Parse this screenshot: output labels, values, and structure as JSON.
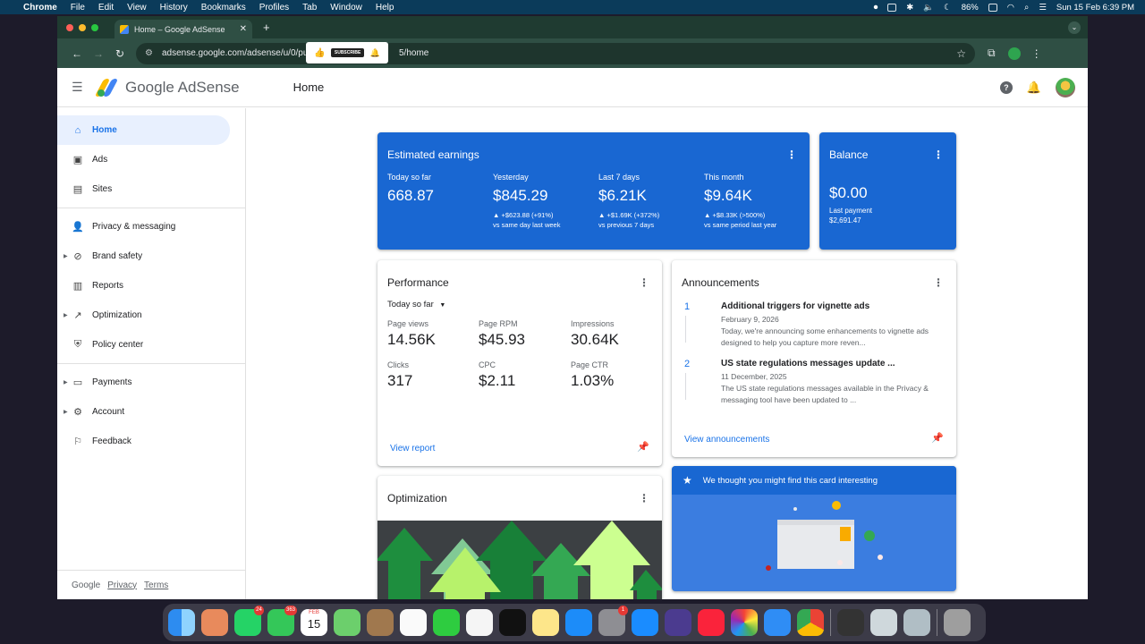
{
  "menubar": {
    "app": "Chrome",
    "items": [
      "File",
      "Edit",
      "View",
      "History",
      "Bookmarks",
      "Profiles",
      "Tab",
      "Window",
      "Help"
    ],
    "battery": "86%",
    "clock": "Sun 15 Feb  6:39 PM"
  },
  "browser": {
    "tab_title": "Home – Google AdSense",
    "url_left": "adsense.google.com/adsense/u/0/pub",
    "url_right": "5/home",
    "subscribe_label": "SUBSCRIBE"
  },
  "header": {
    "brand": "Google AdSense",
    "page_title": "Home"
  },
  "sidebar": {
    "items": [
      {
        "label": "Home",
        "icon": "home-icon",
        "active": true
      },
      {
        "label": "Ads",
        "icon": "ads-icon"
      },
      {
        "label": "Sites",
        "icon": "sites-icon"
      },
      {
        "label": "Privacy & messaging",
        "icon": "privacy-icon"
      },
      {
        "label": "Brand safety",
        "icon": "block-icon",
        "expandable": true
      },
      {
        "label": "Reports",
        "icon": "bar-chart-icon"
      },
      {
        "label": "Optimization",
        "icon": "trending-up-icon",
        "expandable": true
      },
      {
        "label": "Policy center",
        "icon": "shield-icon"
      },
      {
        "label": "Payments",
        "icon": "payments-icon",
        "expandable": true
      },
      {
        "label": "Account",
        "icon": "gear-icon",
        "expandable": true
      },
      {
        "label": "Feedback",
        "icon": "feedback-icon"
      }
    ],
    "footer": {
      "google": "Google",
      "privacy": "Privacy",
      "terms": "Terms"
    }
  },
  "earnings": {
    "title": "Estimated earnings",
    "metrics": [
      {
        "label": "Today so far",
        "value": "668.87",
        "change": "",
        "compare": ""
      },
      {
        "label": "Yesterday",
        "value": "$845.29",
        "change": "▲ +$623.88 (+91%)",
        "compare": "vs same day last week"
      },
      {
        "label": "Last 7 days",
        "value": "$6.21K",
        "change": "▲ +$1.69K (+372%)",
        "compare": "vs previous 7 days"
      },
      {
        "label": "This month",
        "value": "$9.64K",
        "change": "▲ +$8.33K (>500%)",
        "compare": "vs same period last year"
      }
    ]
  },
  "balance": {
    "title": "Balance",
    "value": "$0.00",
    "last_payment_label": "Last payment",
    "last_payment_value": "$2,691.47"
  },
  "performance": {
    "title": "Performance",
    "range": "Today so far",
    "metrics": [
      {
        "label": "Page views",
        "value": "14.56K"
      },
      {
        "label": "Page RPM",
        "value": "$45.93"
      },
      {
        "label": "Impressions",
        "value": "30.64K"
      },
      {
        "label": "Clicks",
        "value": "317"
      },
      {
        "label": "CPC",
        "value": "$2.11"
      },
      {
        "label": "Page CTR",
        "value": "1.03%"
      }
    ],
    "link": "View report"
  },
  "announcements": {
    "title": "Announcements",
    "items": [
      {
        "num": "1",
        "title": "Additional triggers for vignette ads",
        "date": "February 9, 2026",
        "text": "Today, we're announcing some enhancements to vignette ads designed to help you capture more reven..."
      },
      {
        "num": "2",
        "title": "US state regulations messages update ...",
        "date": "11 December, 2025",
        "text": "The US state regulations messages available in the Privacy & messaging tool have been updated to ..."
      }
    ],
    "link": "View announcements"
  },
  "optimization": {
    "title": "Optimization"
  },
  "suggestion": {
    "title": "We thought you might find this card interesting"
  },
  "dock_badges": {
    "whatsapp": "24",
    "messages": "363",
    "calendar_month": "FEB",
    "calendar_day": "15",
    "settings": "1"
  },
  "colors": {
    "brand_blue": "#1967d2",
    "link_blue": "#1a73e8",
    "active_bg": "#e8f0fe"
  }
}
